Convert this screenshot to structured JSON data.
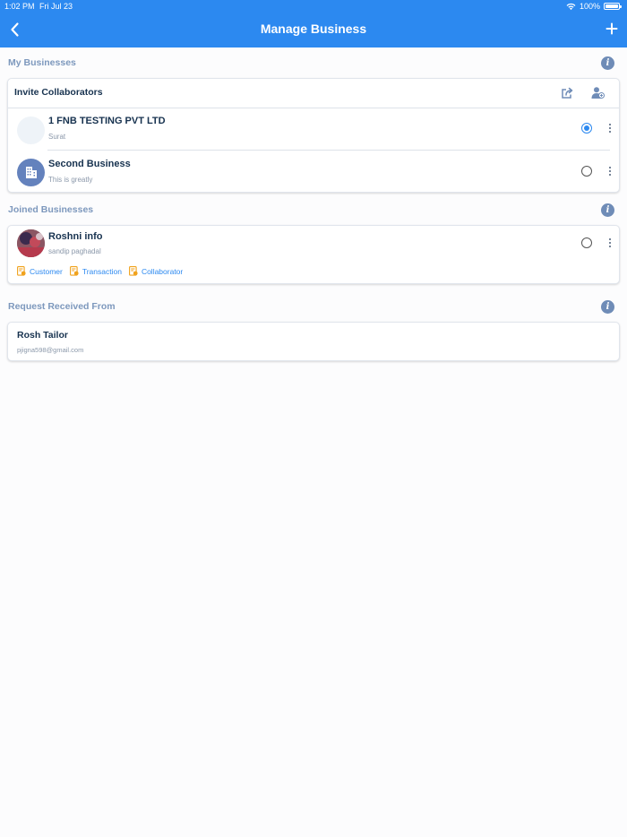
{
  "status_bar": {
    "time": "1:02 PM",
    "date": "Fri Jul 23",
    "battery": "100%"
  },
  "nav": {
    "title": "Manage Business",
    "back_icon": "chevron-left-icon",
    "add_icon": "plus-icon"
  },
  "colors": {
    "primary": "#2c89f0",
    "section_title": "#7d98bd",
    "text_dark": "#17324f",
    "text_muted": "#8b98aa"
  },
  "my_businesses": {
    "title": "My Businesses",
    "invite_label": "Invite Collaborators",
    "items": [
      {
        "name": "1 FNB TESTING PVT LTD",
        "subtitle": "Surat",
        "selected": true
      },
      {
        "name": "Second Business",
        "subtitle": "This is greatly",
        "selected": false
      }
    ]
  },
  "joined_businesses": {
    "title": "Joined Businesses",
    "items": [
      {
        "name": "Roshni info",
        "subtitle": "sandip paghadal",
        "selected": false,
        "permissions": [
          "Customer",
          "Transaction",
          "Collaborator"
        ]
      }
    ]
  },
  "requests": {
    "title": "Request Received From",
    "items": [
      {
        "name": "Rosh Tailor",
        "email": "pjigna598@gmail.com"
      }
    ]
  }
}
